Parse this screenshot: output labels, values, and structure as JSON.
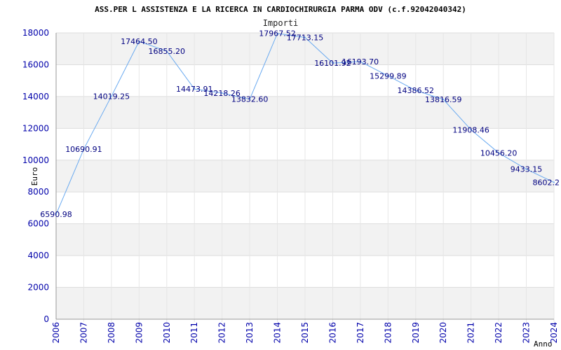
{
  "chart_data": {
    "type": "line",
    "title": "ASS.PER L ASSISTENZA E LA RICERCA IN CARDIOCHIRURGIA PARMA ODV (c.f.92042040342)",
    "series_label": "Importi",
    "xlabel": "Anno",
    "ylabel": "Euro",
    "ylim": [
      0,
      18000
    ],
    "yticks": [
      0,
      2000,
      4000,
      6000,
      8000,
      10000,
      12000,
      14000,
      16000,
      18000
    ],
    "grid": "horizontal-bands",
    "x": [
      "2006",
      "2007",
      "2008",
      "2009",
      "2010",
      "2011",
      "2012",
      "2013",
      "2014",
      "2015",
      "2016",
      "2017",
      "2018",
      "2019",
      "2020",
      "2021",
      "2022",
      "2023",
      "2024"
    ],
    "series": [
      {
        "values": [
          6590.98,
          10690.91,
          14019.25,
          17464.5,
          16855.2,
          14473.91,
          14218.26,
          13832.6,
          17967.52,
          17713.15,
          16101.92,
          16193.7,
          15299.89,
          14386.52,
          13816.59,
          11908.46,
          10456.2,
          9433.15,
          8602.2
        ],
        "labels": [
          "6590.98",
          "10690.91",
          "14019.25",
          "17464.50",
          "16855.20",
          "14473.91",
          "14218.26",
          "13832.60",
          "17967.52",
          "17713.15",
          "16101.92",
          "16193.70",
          "15299.89",
          "14386.52",
          "13816.59",
          "11908.46",
          "10456.20",
          "9433.15",
          "8602.2"
        ]
      }
    ],
    "colors": {
      "line": "#6aaaf0",
      "band": "#f2f2f2",
      "grid": "#dddddd",
      "tick": "#0000aa",
      "label": "#000080"
    }
  }
}
